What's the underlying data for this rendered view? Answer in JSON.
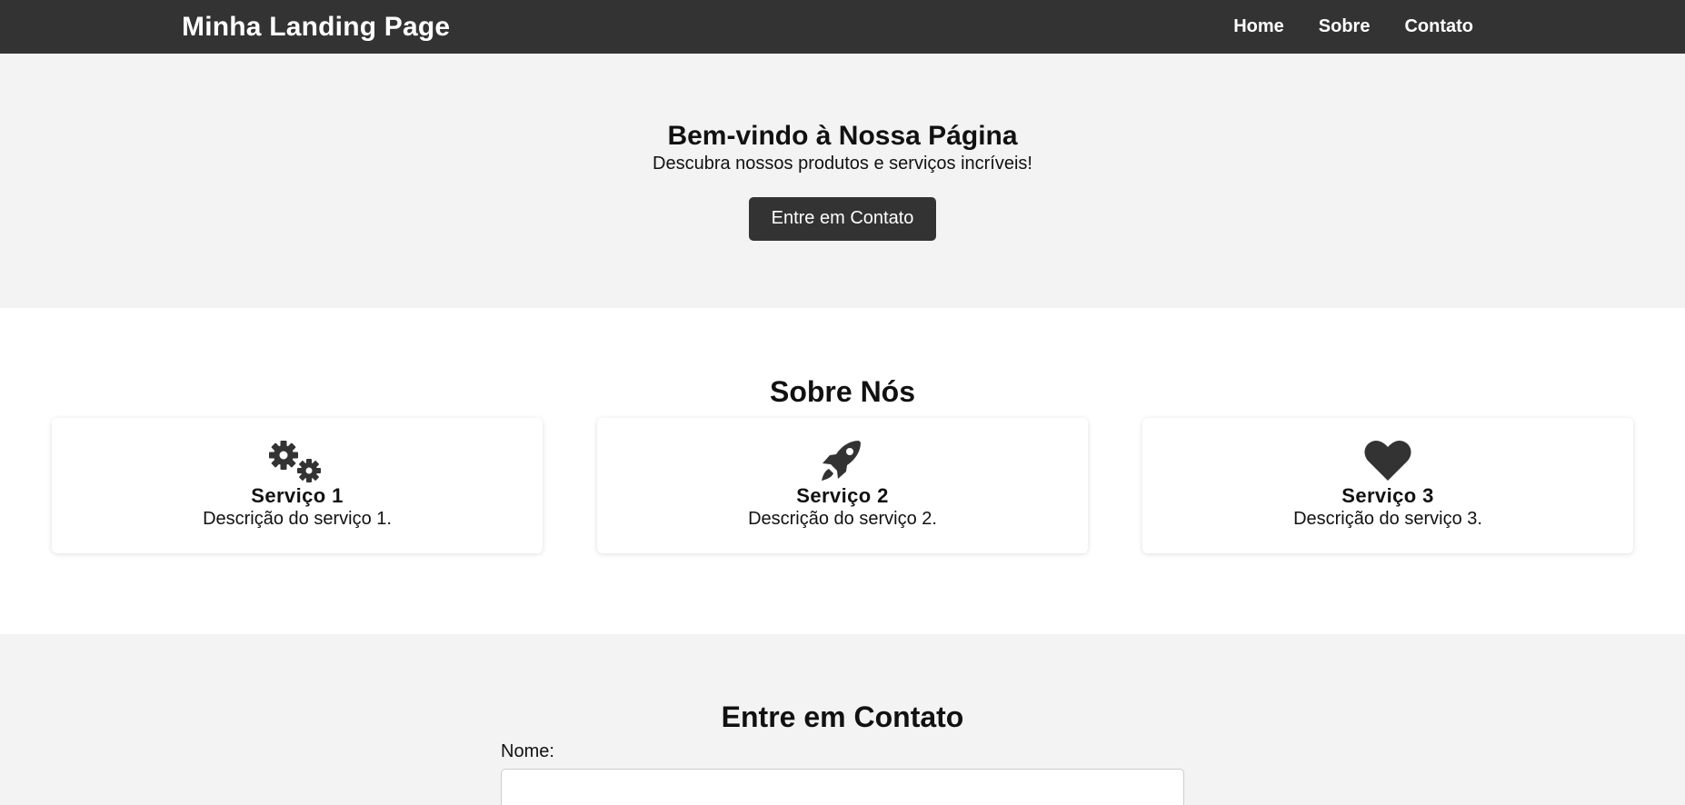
{
  "header": {
    "brand": "Minha Landing Page",
    "nav": [
      {
        "label": "Home"
      },
      {
        "label": "Sobre"
      },
      {
        "label": "Contato"
      }
    ]
  },
  "hero": {
    "title": "Bem-vindo à Nossa Página",
    "subtitle": "Descubra nossos produtos e serviços incríveis!",
    "cta_label": "Entre em Contato"
  },
  "about": {
    "title": "Sobre Nós",
    "services": [
      {
        "icon": "gears-icon",
        "title": "Serviço 1",
        "description": "Descrição do serviço 1."
      },
      {
        "icon": "rocket-icon",
        "title": "Serviço 2",
        "description": "Descrição do serviço 2."
      },
      {
        "icon": "heart-icon",
        "title": "Serviço 3",
        "description": "Descrição do serviço 3."
      }
    ]
  },
  "contact": {
    "title": "Entre em Contato",
    "name_label": "Nome:",
    "name_value": "",
    "name_placeholder": ""
  },
  "colors": {
    "header_bg": "#333333",
    "section_alt_bg": "#f3f3f3",
    "button_bg": "#333333",
    "icon_color": "#333333"
  }
}
